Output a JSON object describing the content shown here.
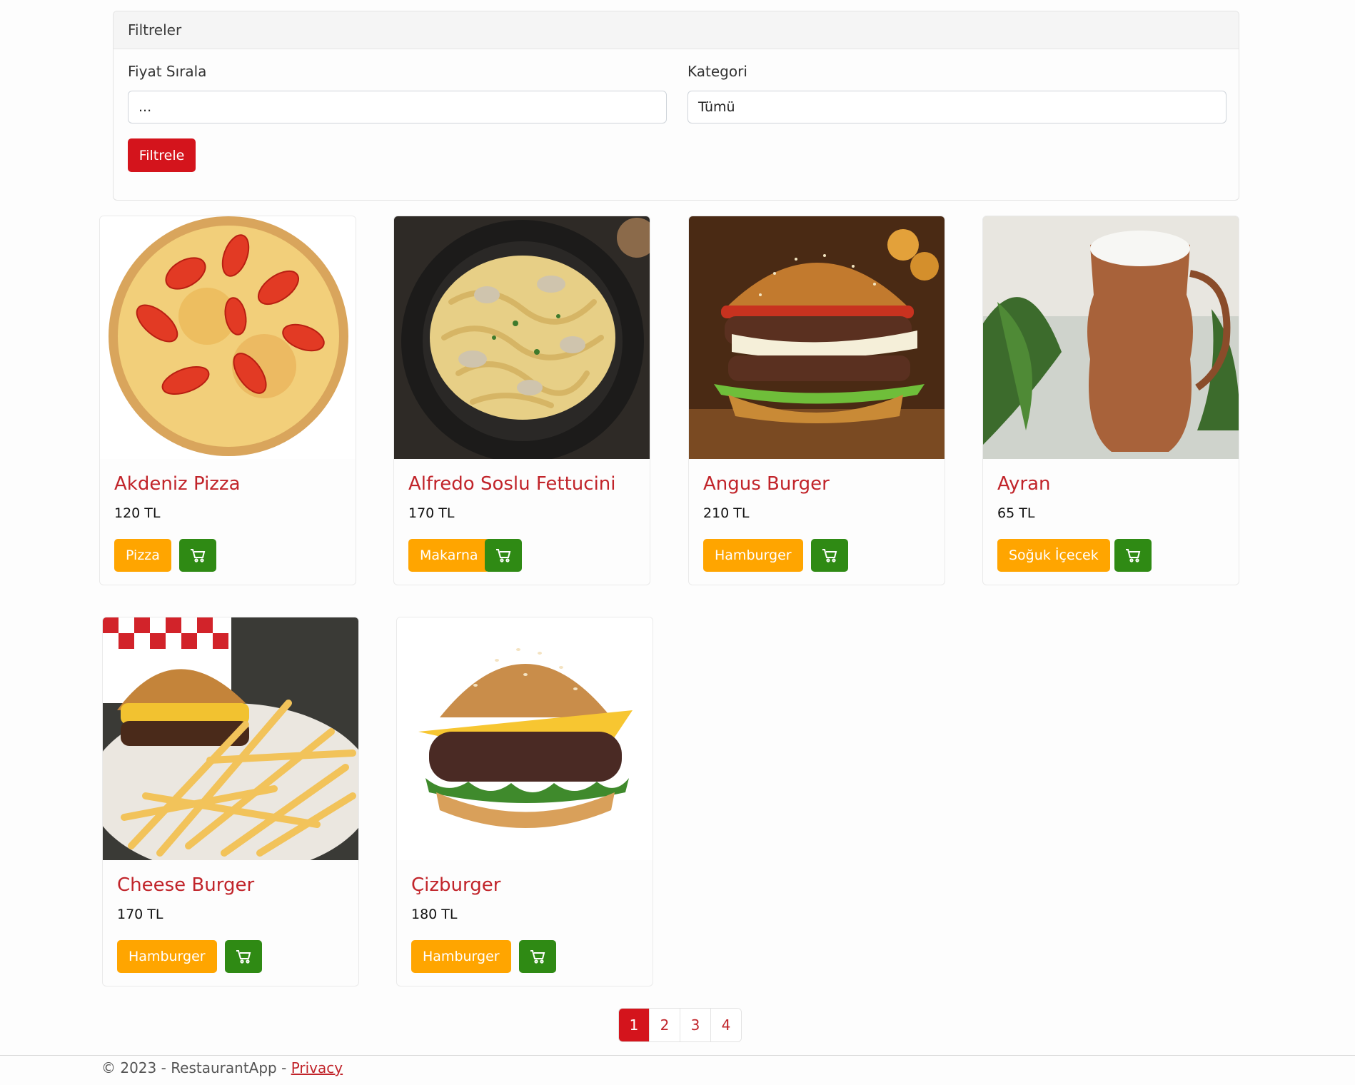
{
  "filters": {
    "header": "Filtreler",
    "price_sort_label": "Fiyat Sırala",
    "price_sort_value": "...",
    "category_label": "Kategori",
    "category_value": "Tümü",
    "filter_button": "Filtrele"
  },
  "products": [
    {
      "name": "Akdeniz Pizza",
      "price": "120 TL",
      "category": "Pizza",
      "image_icon": "pizza-image"
    },
    {
      "name": "Alfredo Soslu Fettucini",
      "price": "170 TL",
      "category": "Makarna",
      "image_icon": "pasta-image"
    },
    {
      "name": "Angus Burger",
      "price": "210 TL",
      "category": "Hamburger",
      "image_icon": "burger-image"
    },
    {
      "name": "Ayran",
      "price": "65 TL",
      "category": "Soğuk İçecek",
      "image_icon": "ayran-image"
    },
    {
      "name": "Cheese Burger",
      "price": "170 TL",
      "category": "Hamburger",
      "image_icon": "burger-fries-image"
    },
    {
      "name": "Çizburger",
      "price": "180 TL",
      "category": "Hamburger",
      "image_icon": "cheeseburger-image"
    }
  ],
  "pagination": {
    "pages": [
      "1",
      "2",
      "3",
      "4"
    ],
    "active": "1"
  },
  "footer": {
    "copyright": "© 2023 - RestaurantApp - ",
    "privacy_link": "Privacy"
  },
  "colors": {
    "primary_red": "#d4141c",
    "title_red": "#c1242a",
    "category_badge": "#ffa500",
    "cart_button": "#2f8a14"
  }
}
